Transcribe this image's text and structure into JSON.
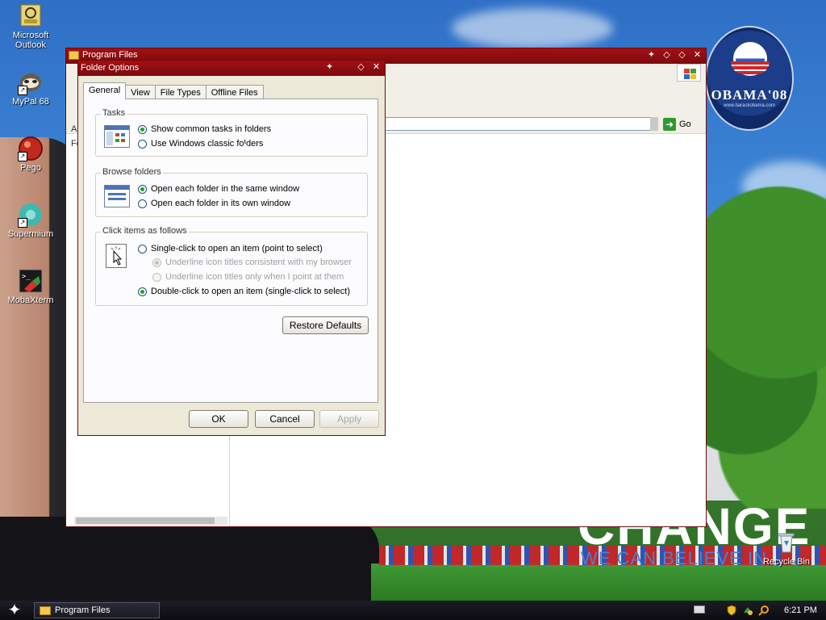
{
  "desktop": {
    "icons": [
      {
        "label": "Microsoft Outlook",
        "icon": "outlook-icon"
      },
      {
        "label": "MyPal 68",
        "icon": "mypal-icon"
      },
      {
        "label": "Pego",
        "icon": "pego-icon"
      },
      {
        "label": "Supermium",
        "icon": "supermium-icon"
      },
      {
        "label": "MobaXterm",
        "icon": "mobaxterm-icon"
      }
    ],
    "recycle_bin": "Recycle Bin",
    "wallpaper_logo": "OBAMA'08",
    "wallpaper_logo_small": "www.barackobama.com",
    "wallpaper_change": "CHANGE",
    "wallpaper_believe": "WE CAN BELIEVE IN"
  },
  "explorer": {
    "title": "Program Files",
    "address_go": "Go",
    "left_fragments": [
      "Ad",
      "Fo"
    ]
  },
  "dialog": {
    "title": "Folder Options",
    "tabs": [
      "General",
      "View",
      "File Types",
      "Offline Files"
    ],
    "active_tab": "General",
    "tasks": {
      "legend": "Tasks",
      "option1": "Show common tasks in folders",
      "option2": "Use Windows classic folders",
      "selected": 1
    },
    "browse": {
      "legend": "Browse folders",
      "option1": "Open each folder in the same window",
      "option2": "Open each folder in its own window",
      "selected": 1
    },
    "click": {
      "legend": "Click items as follows",
      "single": "Single-click to open an item (point to select)",
      "sub1": "Underline icon titles consistent with my browser",
      "sub2": "Underline icon titles only when I point at them",
      "double": "Double-click to open an item (single-click to select)",
      "selected": "double"
    },
    "restore_defaults": "Restore Defaults",
    "ok": "OK",
    "cancel": "Cancel",
    "apply": "Apply"
  },
  "taskbar": {
    "task_button": "Program Files",
    "clock": "6:21 PM"
  },
  "colors": {
    "title_bar": "#a30f14",
    "taskbar": "#0b0b10",
    "radio_selected": "#21a121"
  }
}
